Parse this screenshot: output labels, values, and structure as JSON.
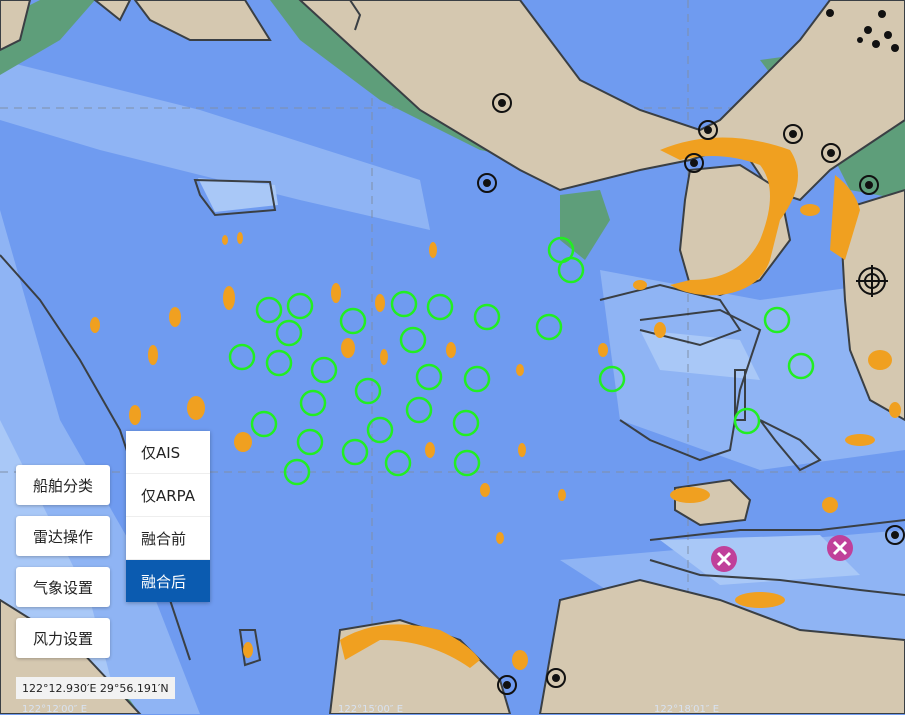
{
  "side_buttons": [
    {
      "label": "船舶分类"
    },
    {
      "label": "雷达操作"
    },
    {
      "label": "气象设置"
    },
    {
      "label": "风力设置"
    }
  ],
  "fusion_menu": {
    "items": [
      {
        "label": "仅AIS"
      },
      {
        "label": "仅ARPA"
      },
      {
        "label": "融合前"
      },
      {
        "label": "融合后"
      }
    ],
    "selected_index": 3
  },
  "cursor_coordinates": "122°12.930′E  29°56.191′N",
  "longitude_labels": [
    "122°12′00″ E",
    "122°15′00″ E",
    "122°18′01″ E"
  ],
  "colors": {
    "deep_water": "#6f9bf0",
    "shallow_water": "#a9c8f7",
    "land": "#d5c8b0",
    "intertidal": "#5e9e7a",
    "radar_echo": "#f0a020",
    "target_ring": "#22ee22",
    "hazard_mark": "#c0409a",
    "menu_selected": "#0b5bb0"
  },
  "icons": [
    "buoy-icon",
    "target-circle-icon",
    "hazard-mark-icon",
    "lighthouse-icon"
  ]
}
